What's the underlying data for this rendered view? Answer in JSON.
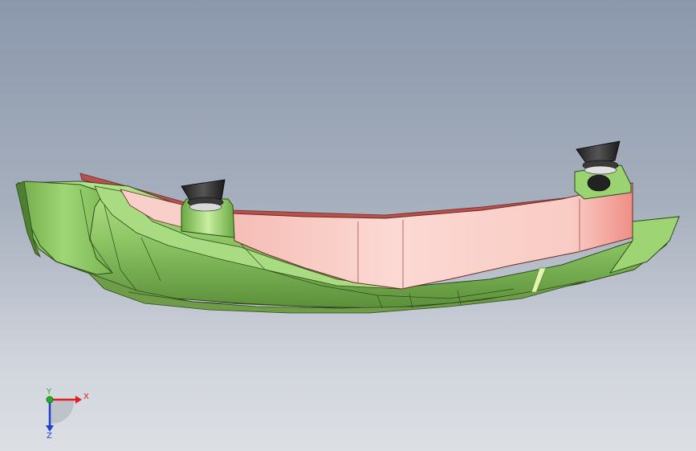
{
  "viewport": {
    "background_top": "#8b98ac",
    "background_bottom": "#dcdfe4"
  },
  "model": {
    "body_color": "#8fc766",
    "panel_color": "#f7c8c3",
    "mount_color": "#2e2e2e"
  },
  "triad": {
    "x_label": "X",
    "y_label": "Y",
    "z_label": "Z",
    "x_color": "#e02020",
    "y_color": "#20b020",
    "z_color": "#2040d0"
  }
}
